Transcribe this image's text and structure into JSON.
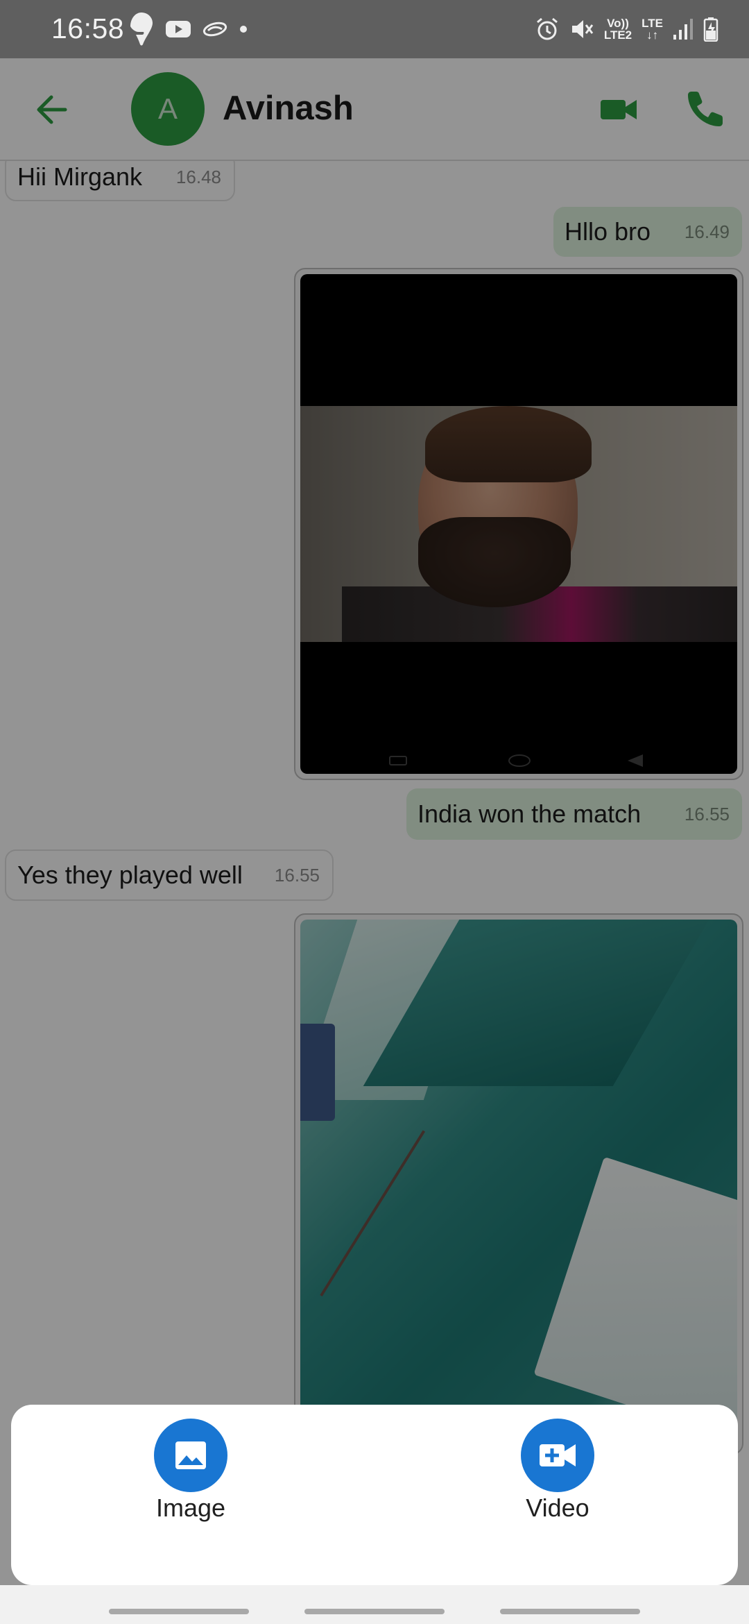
{
  "status_bar": {
    "time": "16:58",
    "left_icons": [
      "swiggy-icon",
      "youtube-icon",
      "app-icon",
      "dot-icon"
    ],
    "right_icons": [
      "alarm-icon",
      "mute-icon",
      "volte-icon",
      "lte-icon",
      "signal-icon",
      "battery-charging-icon"
    ],
    "volte_line1": "Vo))",
    "volte_line2": "LTE2",
    "lte_label": "LTE"
  },
  "header": {
    "contact_initial": "A",
    "contact_name": "Avinash",
    "accent_color": "#2e9d42"
  },
  "messages": [
    {
      "direction": "in",
      "text": "Hii Mirgank",
      "time": "16.48"
    },
    {
      "direction": "out",
      "text": "Hllo bro",
      "time": "16.49"
    },
    {
      "direction": "out",
      "type": "image",
      "description": "phone screenshot of a portrait"
    },
    {
      "direction": "out",
      "text": "India won the match",
      "time": "16.55"
    },
    {
      "direction": "in",
      "text": "Yes they played well",
      "time": "16.55"
    },
    {
      "direction": "out",
      "type": "image",
      "description": "teal surfaces photo"
    }
  ],
  "attach_sheet": {
    "options": [
      {
        "label": "Image",
        "icon": "image-icon"
      },
      {
        "label": "Video",
        "icon": "video-add-icon"
      }
    ],
    "button_color": "#1976d2"
  }
}
